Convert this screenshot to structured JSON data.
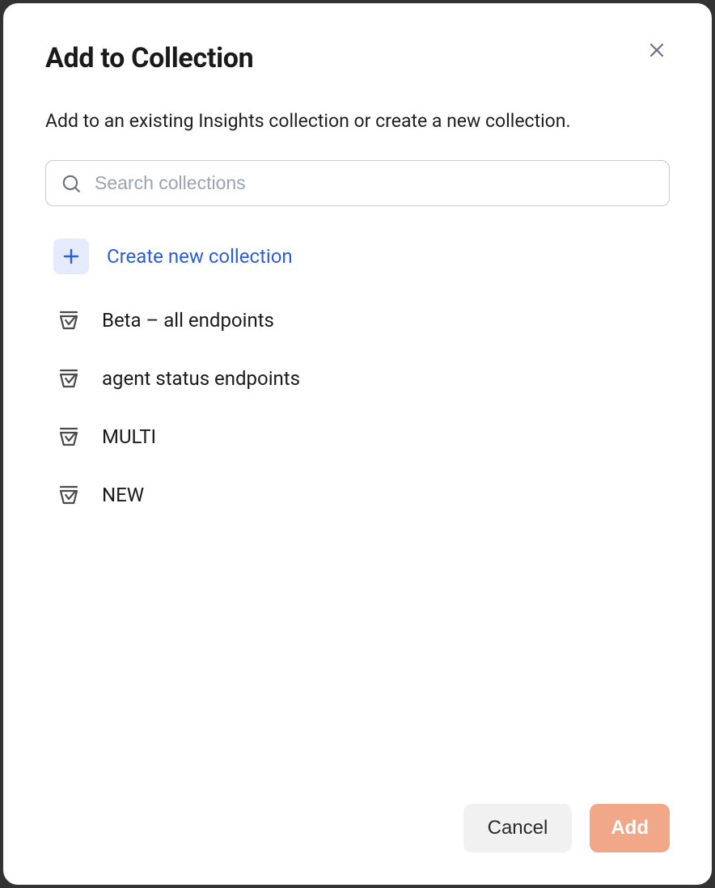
{
  "modal": {
    "title": "Add to Collection",
    "subtitle": "Add to an existing Insights collection or create a new collection.",
    "search_placeholder": "Search collections",
    "create_label": "Create new collection",
    "collections": [
      {
        "label": "Beta – all endpoints"
      },
      {
        "label": "agent status endpoints"
      },
      {
        "label": "MULTI"
      },
      {
        "label": "NEW"
      }
    ],
    "buttons": {
      "cancel": "Cancel",
      "add": "Add"
    }
  }
}
